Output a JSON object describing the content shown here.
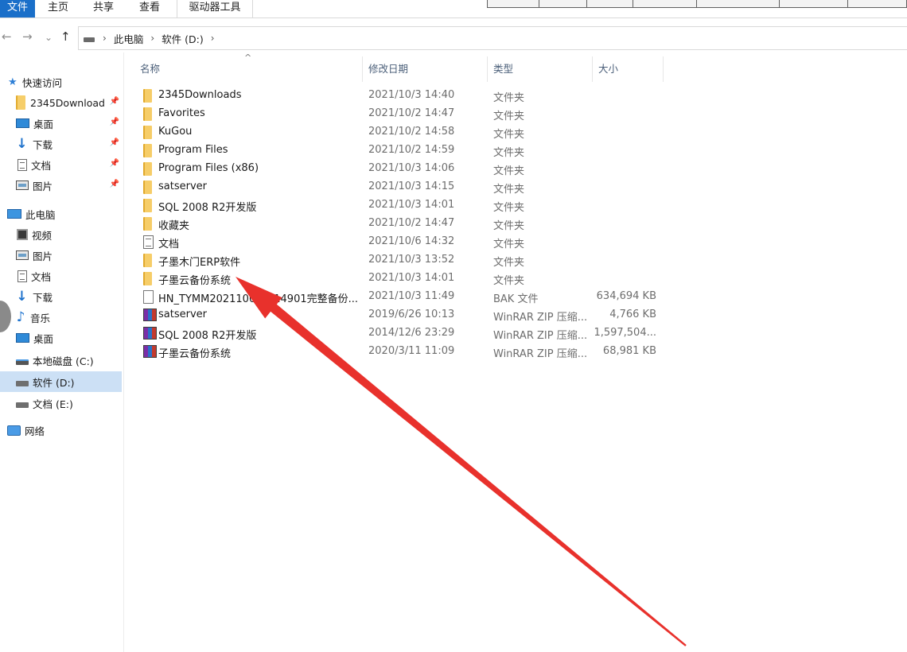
{
  "ribbon": {
    "tabs": [
      {
        "id": "file",
        "label": "文件"
      },
      {
        "id": "home",
        "label": "主页"
      },
      {
        "id": "share",
        "label": "共享"
      },
      {
        "id": "view",
        "label": "查看"
      },
      {
        "id": "drive",
        "label": "驱动器工具"
      }
    ]
  },
  "nav": {
    "back_icon": "←",
    "forward_icon": "→",
    "recent_icon": "⌄",
    "up_icon": "↑",
    "breadcrumb": [
      "此电脑",
      "软件 (D:)"
    ],
    "separator": "›"
  },
  "sidebar": {
    "items": [
      {
        "label": "快速访问",
        "icon": "star-icon"
      },
      {
        "label": "2345Download",
        "icon": "folder-icon",
        "pinned": true
      },
      {
        "label": "桌面",
        "icon": "desktop-icon",
        "pinned": true
      },
      {
        "label": "下载",
        "icon": "download-icon",
        "pinned": true
      },
      {
        "label": "文档",
        "icon": "document-icon",
        "pinned": true
      },
      {
        "label": "图片",
        "icon": "picture-icon",
        "pinned": true
      },
      {
        "label": "此电脑",
        "icon": "computer-icon"
      },
      {
        "label": "视频",
        "icon": "video-icon"
      },
      {
        "label": "图片",
        "icon": "picture-icon"
      },
      {
        "label": "文档",
        "icon": "document-icon"
      },
      {
        "label": "下载",
        "icon": "download-icon"
      },
      {
        "label": "音乐",
        "icon": "music-icon"
      },
      {
        "label": "桌面",
        "icon": "desktop-icon"
      },
      {
        "label": "本地磁盘 (C:)",
        "icon": "system-drive-icon"
      },
      {
        "label": "软件 (D:)",
        "icon": "drive-icon",
        "selected": true
      },
      {
        "label": "文档 (E:)",
        "icon": "drive-icon"
      },
      {
        "label": "网络",
        "icon": "network-icon"
      }
    ],
    "selected_color": "#cce0f5"
  },
  "columns": {
    "name": "名称",
    "date": "修改日期",
    "type": "类型",
    "size": "大小"
  },
  "files": [
    {
      "name": "2345Downloads",
      "date": "2021/10/3 14:40",
      "type": "文件夹",
      "size": "",
      "icon": "folder-icon"
    },
    {
      "name": "Favorites",
      "date": "2021/10/2 14:47",
      "type": "文件夹",
      "size": "",
      "icon": "folder-icon"
    },
    {
      "name": "KuGou",
      "date": "2021/10/2 14:58",
      "type": "文件夹",
      "size": "",
      "icon": "folder-icon"
    },
    {
      "name": "Program Files",
      "date": "2021/10/2 14:59",
      "type": "文件夹",
      "size": "",
      "icon": "folder-icon"
    },
    {
      "name": "Program Files (x86)",
      "date": "2021/10/3 14:06",
      "type": "文件夹",
      "size": "",
      "icon": "folder-icon"
    },
    {
      "name": "satserver",
      "date": "2021/10/3 14:15",
      "type": "文件夹",
      "size": "",
      "icon": "folder-icon"
    },
    {
      "name": "SQL 2008 R2开发版",
      "date": "2021/10/3 14:01",
      "type": "文件夹",
      "size": "",
      "icon": "folder-icon"
    },
    {
      "name": "收藏夹",
      "date": "2021/10/2 14:47",
      "type": "文件夹",
      "size": "",
      "icon": "folder-icon"
    },
    {
      "name": "文档",
      "date": "2021/10/6 14:32",
      "type": "文件夹",
      "size": "",
      "icon": "document-icon"
    },
    {
      "name": "子墨木门ERP软件",
      "date": "2021/10/3 13:52",
      "type": "文件夹",
      "size": "",
      "icon": "folder-icon"
    },
    {
      "name": "子墨云备份系统",
      "date": "2021/10/3 14:01",
      "type": "文件夹",
      "size": "",
      "icon": "folder-icon"
    },
    {
      "name": "HN_TYMM20211003_114901完整备份...",
      "date": "2021/10/3 11:49",
      "type": "BAK 文件",
      "size": "634,694 KB",
      "icon": "file-icon"
    },
    {
      "name": "satserver",
      "date": "2019/6/26 10:13",
      "type": "WinRAR ZIP 压缩...",
      "size": "4,766 KB",
      "icon": "winrar-icon"
    },
    {
      "name": "SQL 2008 R2开发版",
      "date": "2014/12/6 23:29",
      "type": "WinRAR ZIP 压缩...",
      "size": "1,597,504...",
      "icon": "winrar-icon"
    },
    {
      "name": "子墨云备份系统",
      "date": "2020/3/11 11:09",
      "type": "WinRAR ZIP 压缩...",
      "size": "68,981 KB",
      "icon": "winrar-icon"
    }
  ],
  "annotation": {
    "color": "#e8312c",
    "target_item": "子墨云备份系统"
  }
}
